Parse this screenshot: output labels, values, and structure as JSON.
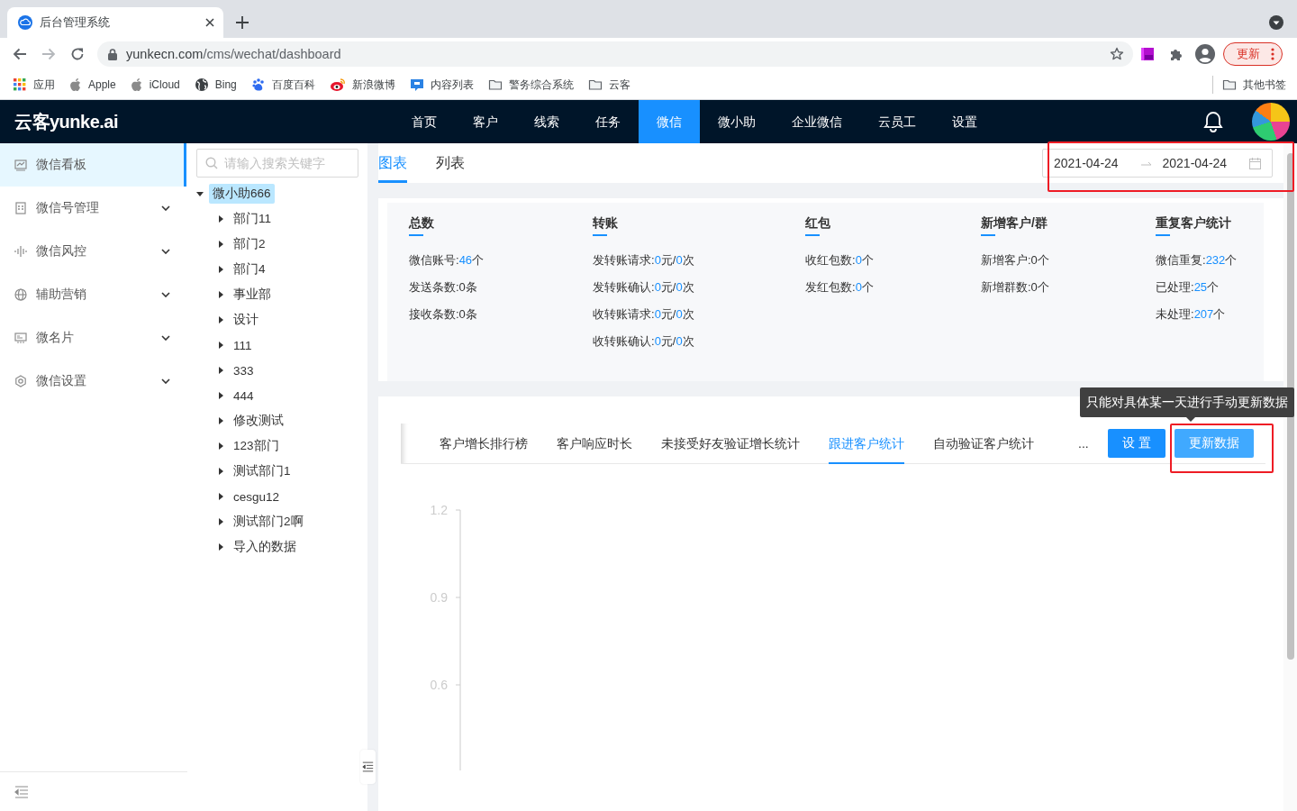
{
  "browser": {
    "tab_title": "后台管理系统",
    "url_host": "yunkecn.com",
    "url_path": "/cms/wechat/dashboard",
    "update_button": "更新",
    "bookmarks": [
      {
        "label": "应用",
        "kind": "apps"
      },
      {
        "label": "Apple",
        "kind": "apple"
      },
      {
        "label": "iCloud",
        "kind": "apple"
      },
      {
        "label": "Bing",
        "kind": "globe"
      },
      {
        "label": "百度百科",
        "kind": "paw"
      },
      {
        "label": "新浪微博",
        "kind": "weibo"
      },
      {
        "label": "内容列表",
        "kind": "chat"
      },
      {
        "label": "警务综合系统",
        "kind": "folder"
      },
      {
        "label": "云客",
        "kind": "folder"
      }
    ],
    "other_bookmarks": "其他书签"
  },
  "header": {
    "logo": "云客yunke.ai",
    "nav": [
      {
        "label": "首页",
        "selected": false
      },
      {
        "label": "客户",
        "selected": false
      },
      {
        "label": "线索",
        "selected": false
      },
      {
        "label": "任务",
        "selected": false
      },
      {
        "label": "微信",
        "selected": true
      },
      {
        "label": "微小助",
        "selected": false
      },
      {
        "label": "企业微信",
        "selected": false
      },
      {
        "label": "云员工",
        "selected": false
      },
      {
        "label": "设置",
        "selected": false
      }
    ]
  },
  "sidebar": {
    "items": [
      {
        "label": "微信看板",
        "kind": "chart",
        "selected": true,
        "has_submenu": false
      },
      {
        "label": "微信号管理",
        "kind": "doc",
        "selected": false,
        "has_submenu": true
      },
      {
        "label": "微信风控",
        "kind": "wave",
        "selected": false,
        "has_submenu": true
      },
      {
        "label": "辅助营销",
        "kind": "globe",
        "selected": false,
        "has_submenu": true
      },
      {
        "label": "微名片",
        "kind": "card",
        "selected": false,
        "has_submenu": true
      },
      {
        "label": "微信设置",
        "kind": "gear",
        "selected": false,
        "has_submenu": true
      }
    ]
  },
  "tree": {
    "search_placeholder": "请输入搜索关键字",
    "nodes": [
      {
        "label": "微小助666",
        "expanded": true,
        "selected": true,
        "children": [
          {
            "label": "部门11",
            "expanded": false,
            "selected": false
          },
          {
            "label": "部门2",
            "expanded": false,
            "selected": false
          },
          {
            "label": "部门4",
            "expanded": false,
            "selected": false
          },
          {
            "label": "事业部",
            "expanded": false,
            "selected": false
          },
          {
            "label": "设计",
            "expanded": false,
            "selected": false
          },
          {
            "label": "111",
            "expanded": false,
            "selected": false
          },
          {
            "label": "333",
            "expanded": false,
            "selected": false
          },
          {
            "label": "444",
            "expanded": false,
            "selected": false
          },
          {
            "label": "修改测试",
            "expanded": false,
            "selected": false
          },
          {
            "label": "123部门",
            "expanded": false,
            "selected": false
          },
          {
            "label": "测试部门1",
            "expanded": false,
            "selected": false
          },
          {
            "label": "cesgu12",
            "expanded": false,
            "selected": false
          },
          {
            "label": "测试部门2啊",
            "expanded": false,
            "selected": false
          },
          {
            "label": "导入的数据",
            "expanded": false,
            "selected": false
          }
        ]
      }
    ]
  },
  "main": {
    "view_tabs": [
      {
        "label": "图表",
        "selected": true
      },
      {
        "label": "列表",
        "selected": false
      }
    ],
    "date_range": {
      "start": "2021-04-24",
      "end": "2021-04-24",
      "annotated": true
    },
    "stats": [
      {
        "title": "总数",
        "lines": [
          [
            {
              "text": "微信账号:",
              "highlight": false
            },
            {
              "text": "46",
              "highlight": true
            },
            {
              "text": "个",
              "highlight": false
            }
          ],
          [
            {
              "text": "发送条数:0条",
              "highlight": false
            }
          ],
          [
            {
              "text": "接收条数:0条",
              "highlight": false
            }
          ]
        ]
      },
      {
        "title": "转账",
        "lines": [
          [
            {
              "text": "发转账请求:",
              "highlight": false
            },
            {
              "text": "0",
              "highlight": true
            },
            {
              "text": "元/",
              "highlight": false
            },
            {
              "text": "0",
              "highlight": true
            },
            {
              "text": "次",
              "highlight": false
            }
          ],
          [
            {
              "text": "发转账确认:",
              "highlight": false
            },
            {
              "text": "0",
              "highlight": true
            },
            {
              "text": "元/",
              "highlight": false
            },
            {
              "text": "0",
              "highlight": true
            },
            {
              "text": "次",
              "highlight": false
            }
          ],
          [
            {
              "text": "收转账请求:",
              "highlight": false
            },
            {
              "text": "0",
              "highlight": true
            },
            {
              "text": "元/",
              "highlight": false
            },
            {
              "text": "0",
              "highlight": true
            },
            {
              "text": "次",
              "highlight": false
            }
          ],
          [
            {
              "text": "收转账确认:",
              "highlight": false
            },
            {
              "text": "0",
              "highlight": true
            },
            {
              "text": "元/",
              "highlight": false
            },
            {
              "text": "0",
              "highlight": true
            },
            {
              "text": "次",
              "highlight": false
            }
          ]
        ]
      },
      {
        "title": "红包",
        "lines": [
          [
            {
              "text": "收红包数:",
              "highlight": false
            },
            {
              "text": "0",
              "highlight": true
            },
            {
              "text": "个",
              "highlight": false
            }
          ],
          [
            {
              "text": "发红包数:",
              "highlight": false
            },
            {
              "text": "0",
              "highlight": true
            },
            {
              "text": "个",
              "highlight": false
            }
          ]
        ]
      },
      {
        "title": "新增客户/群",
        "lines": [
          [
            {
              "text": "新增客户:0个",
              "highlight": false
            }
          ],
          [
            {
              "text": "新增群数:0个",
              "highlight": false
            }
          ]
        ]
      },
      {
        "title": "重复客户统计",
        "lines": [
          [
            {
              "text": "微信重复:",
              "highlight": false
            },
            {
              "text": "232",
              "highlight": true
            },
            {
              "text": "个",
              "highlight": false
            }
          ],
          [
            {
              "text": "已处理:",
              "highlight": false
            },
            {
              "text": "25",
              "highlight": true
            },
            {
              "text": "个",
              "highlight": false
            }
          ],
          [
            {
              "text": "未处理:",
              "highlight": false
            },
            {
              "text": "207",
              "highlight": true
            },
            {
              "text": "个",
              "highlight": false
            }
          ]
        ]
      }
    ],
    "report_tabs": [
      {
        "label": "客户增长排行榜",
        "selected": false
      },
      {
        "label": "客户响应时长",
        "selected": false
      },
      {
        "label": "未接受好友验证增长统计",
        "selected": false
      },
      {
        "label": "跟进客户统计",
        "selected": true
      },
      {
        "label": "自动验证客户统计",
        "selected": false
      }
    ],
    "more": "...",
    "settings_button": "设 置",
    "update_button": {
      "label": "更新数据",
      "annotated": true
    },
    "tooltip": "只能对具体某一天进行手动更新数据",
    "chart": {
      "y_axis_labels": [
        "1.2",
        "0.9",
        "0.6"
      ]
    }
  }
}
